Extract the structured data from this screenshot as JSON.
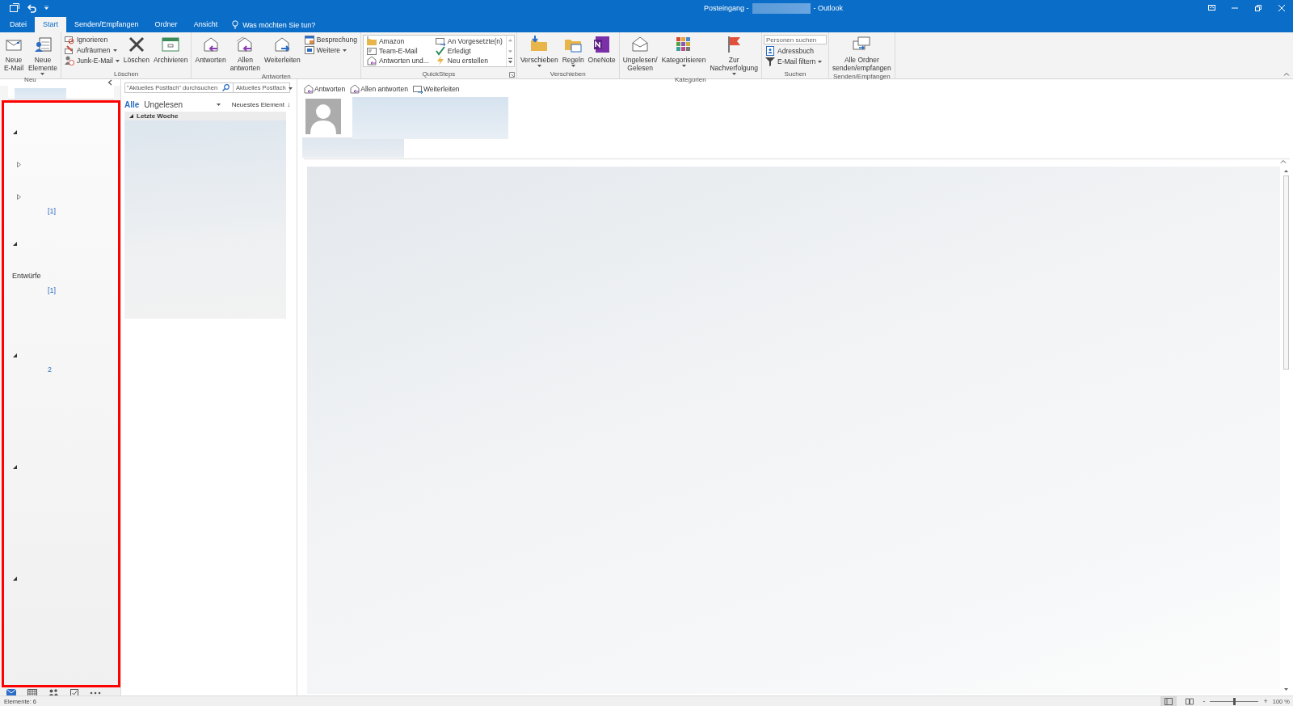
{
  "window": {
    "title_prefix": "Posteingang -",
    "title_suffix": "- Outlook"
  },
  "tabs": [
    {
      "label": "Datei",
      "selected": false
    },
    {
      "label": "Start",
      "selected": true
    },
    {
      "label": "Senden/Empfangen",
      "selected": false
    },
    {
      "label": "Ordner",
      "selected": false
    },
    {
      "label": "Ansicht",
      "selected": false
    }
  ],
  "tell_me": {
    "placeholder": "Was möchten Sie tun?"
  },
  "ribbon": {
    "groups": [
      {
        "label": "Neu",
        "launcher": false,
        "items": [
          {
            "kind": "large",
            "label": "Neue\nE-Mail",
            "dropdown": false
          },
          {
            "kind": "large",
            "label": "Neue\nElemente",
            "dropdown": true
          }
        ]
      },
      {
        "label": "Löschen",
        "launcher": false,
        "items": [
          {
            "kind": "stack",
            "entries": [
              {
                "label": "Ignorieren",
                "dropdown": false
              },
              {
                "label": "Aufräumen",
                "dropdown": true
              },
              {
                "label": "Junk-E-Mail",
                "dropdown": true
              }
            ]
          },
          {
            "kind": "large",
            "label": "Löschen",
            "dropdown": false
          },
          {
            "kind": "large",
            "label": "Archivieren",
            "dropdown": false
          }
        ]
      },
      {
        "label": "Antworten",
        "launcher": false,
        "items": [
          {
            "kind": "large",
            "label": "Antworten",
            "dropdown": false
          },
          {
            "kind": "large",
            "label": "Allen\nantworten",
            "dropdown": false
          },
          {
            "kind": "large",
            "label": "Weiterleiten",
            "dropdown": false
          },
          {
            "kind": "stack",
            "entries": [
              {
                "label": "Besprechung",
                "dropdown": false
              },
              {
                "label": "Weitere",
                "dropdown": true
              }
            ]
          }
        ]
      },
      {
        "label": "QuickSteps",
        "launcher": true,
        "items": [
          {
            "kind": "gallery",
            "entries": [
              {
                "label": "Amazon"
              },
              {
                "label": "Team-E-Mail"
              },
              {
                "label": "Antworten und..."
              },
              {
                "label": "An Vorgesetzte(n)"
              },
              {
                "label": "Erledigt"
              },
              {
                "label": "Neu erstellen"
              }
            ]
          }
        ]
      },
      {
        "label": "Verschieben",
        "launcher": false,
        "items": [
          {
            "kind": "large",
            "label": "Verschieben",
            "dropdown": true
          },
          {
            "kind": "large",
            "label": "Regeln",
            "dropdown": true
          },
          {
            "kind": "large",
            "label": "OneNote",
            "dropdown": false
          }
        ]
      },
      {
        "label": "Kategorien",
        "launcher": false,
        "items": [
          {
            "kind": "large",
            "label": "Ungelesen/\nGelesen",
            "dropdown": false
          },
          {
            "kind": "large",
            "label": "Kategorisieren",
            "dropdown": true
          },
          {
            "kind": "large",
            "label": "Zur\nNachverfolgung",
            "dropdown": true
          }
        ]
      },
      {
        "label": "Suchen",
        "launcher": false,
        "items": [
          {
            "kind": "search",
            "placeholder": "Personen suchen",
            "entries": [
              {
                "label": "Adressbuch",
                "dropdown": false
              },
              {
                "label": "E-Mail filtern",
                "dropdown": true
              }
            ]
          }
        ]
      },
      {
        "label": "Senden/Empfangen",
        "launcher": false,
        "items": [
          {
            "kind": "large",
            "label": "Alle Ordner\nsenden/empfangen",
            "dropdown": false
          }
        ]
      }
    ]
  },
  "folder_pane": {
    "groups": [
      {
        "expanded": true,
        "children": [
          {
            "expanded": false
          },
          {
            "expanded": false,
            "count": "[1]"
          }
        ]
      },
      {
        "expanded": true,
        "children": [
          {
            "label": "Entwürfe"
          },
          {
            "count": "[1]"
          }
        ]
      },
      {
        "expanded": true,
        "children": [
          {
            "count": "2"
          }
        ]
      },
      {
        "expanded": true
      },
      {
        "expanded": true
      }
    ]
  },
  "nav_bar": [
    {
      "selected": true
    },
    {
      "selected": false
    },
    {
      "selected": false
    },
    {
      "selected": false
    },
    {
      "selected": false
    }
  ],
  "message_list": {
    "search": {
      "placeholder": "\"Aktuelles Postfach\" durchsuchen"
    },
    "scope": "Aktuelles Postfach",
    "filters": [
      {
        "label": "Alle",
        "selected": true
      },
      {
        "label": "Ungelesen",
        "selected": false
      }
    ],
    "sort": "Neuestes Element",
    "sort_arrow": "↓",
    "group": {
      "label": "Letzte Woche",
      "expanded": true
    }
  },
  "reading_pane": {
    "actions": [
      {
        "label": "Antworten"
      },
      {
        "label": "Allen antworten"
      },
      {
        "label": "Weiterleiten"
      }
    ]
  },
  "status_bar": {
    "text": "Elemente: 6",
    "zoom_minus": "-",
    "zoom_plus": "+",
    "zoom": {
      "level": 0.5
    },
    "zoom_text": "100 %"
  }
}
